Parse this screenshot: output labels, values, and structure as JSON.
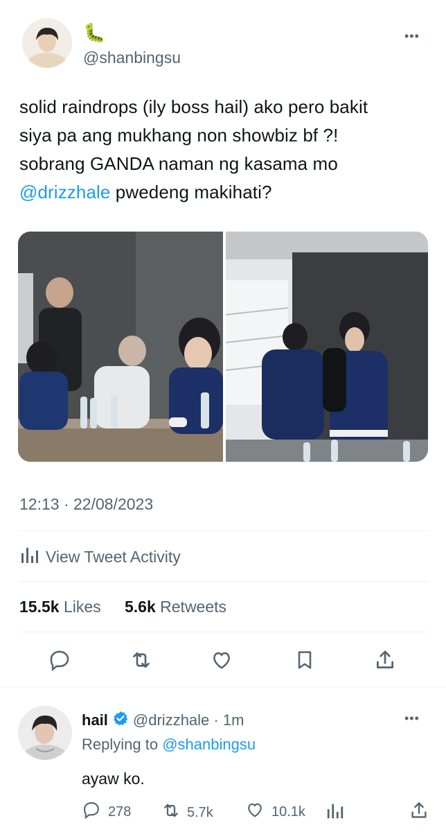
{
  "tweet": {
    "caterpillar_emoji": "🐛",
    "handle": "@shanbingsu",
    "more_label": "•••",
    "text_line1": "solid raindrops (ily boss hail) ako pero bakit",
    "text_line2": "siya pa ang mukhang non showbiz bf ?!",
    "text_line3": "sobrang GANDA naman ng kasama mo",
    "mention": "@drizzhale",
    "text_line4_rest": " pwedeng makihati?",
    "timestamp": "12:13 · 22/08/2023",
    "activity_label": "View Tweet Activity",
    "likes_count": "15.5k",
    "likes_label": "Likes",
    "retweets_count": "5.6k",
    "retweets_label": "Retweets"
  },
  "reply": {
    "name": "hail",
    "handle_time": "@drizzhale · 1m",
    "replying_prefix": "Replying to",
    "replying_to": "@shanbingsu",
    "text": "ayaw ko.",
    "reply_count": "278",
    "retweet_count": "5.7k",
    "like_count": "10.1k",
    "more_label": "•••"
  },
  "colors": {
    "accent": "#1d9bf0",
    "text": "#0f1419",
    "muted": "#536471",
    "divider": "#eff3f4"
  },
  "icons": [
    "caterpillar-emoji",
    "more-icon",
    "activity-icon",
    "reply-icon",
    "retweet-icon",
    "like-icon",
    "bookmark-icon",
    "share-icon",
    "verified-icon",
    "views-icon"
  ]
}
